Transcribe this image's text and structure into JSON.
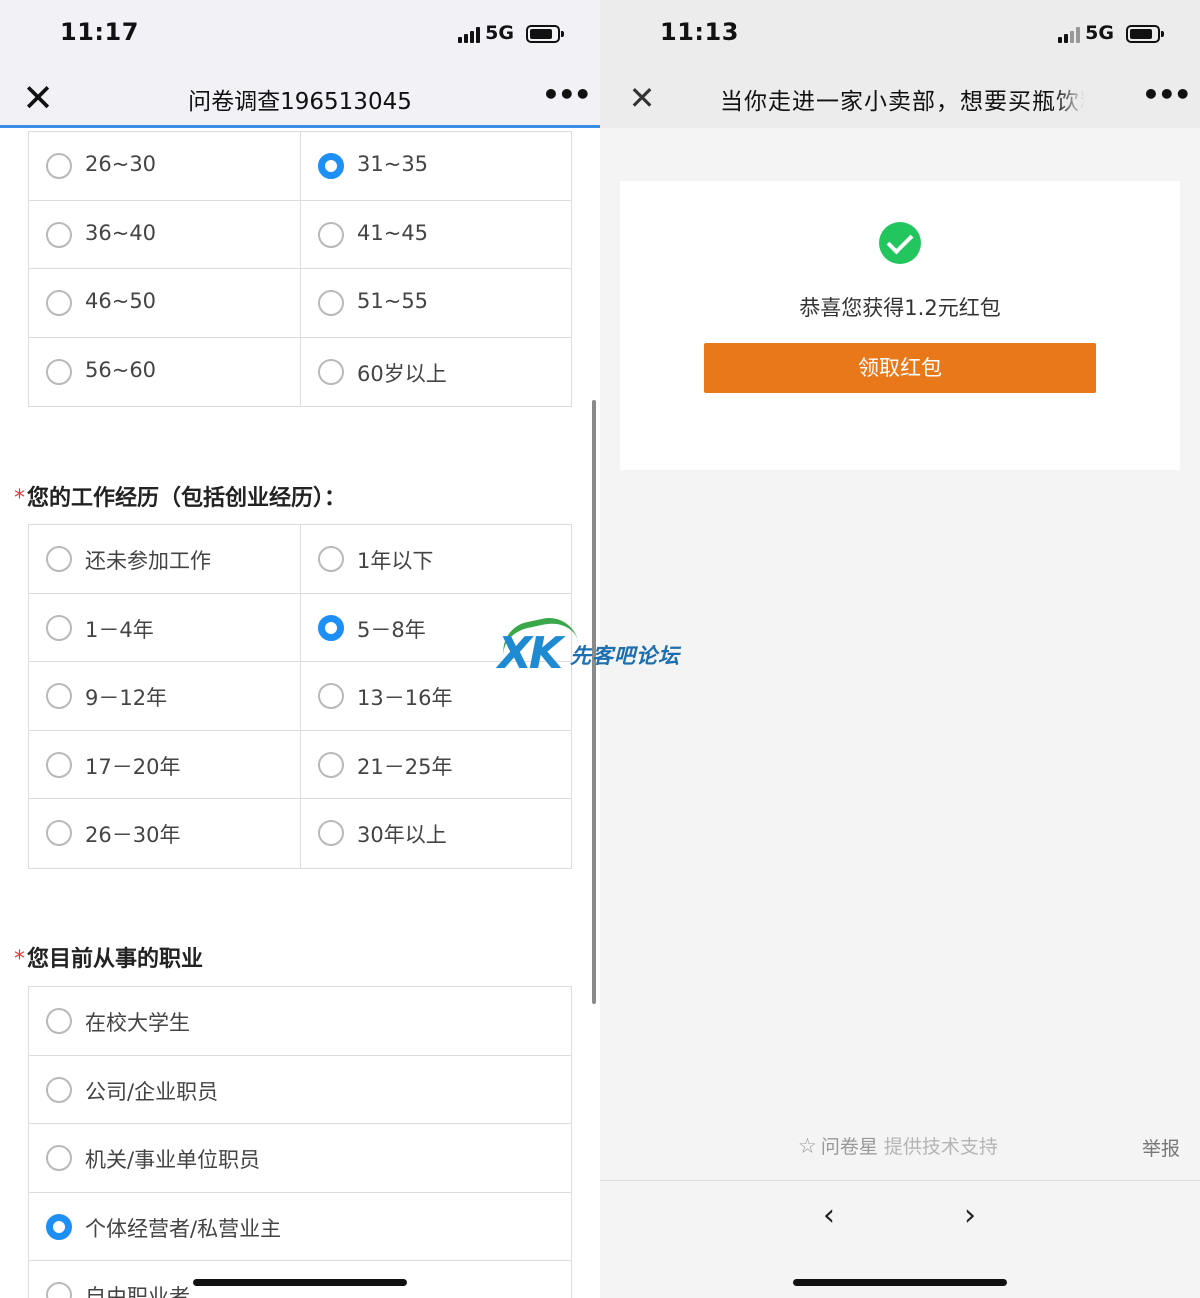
{
  "left": {
    "status": {
      "time": "11:17",
      "network": "5G"
    },
    "nav": {
      "close": "✕",
      "title": "问卷调查196513045",
      "more": "•••"
    },
    "age_options": [
      {
        "label": "26~30",
        "checked": false
      },
      {
        "label": "31~35",
        "checked": true
      },
      {
        "label": "36~40",
        "checked": false
      },
      {
        "label": "41~45",
        "checked": false
      },
      {
        "label": "46~50",
        "checked": false
      },
      {
        "label": "51~55",
        "checked": false
      },
      {
        "label": "56~60",
        "checked": false
      },
      {
        "label": "60岁以上",
        "checked": false
      }
    ],
    "q_work": {
      "required_mark": "*",
      "title": "您的工作经历（包括创业经历）：",
      "options": [
        {
          "label": "还未参加工作",
          "checked": false
        },
        {
          "label": "1年以下",
          "checked": false
        },
        {
          "label": "1－4年",
          "checked": false
        },
        {
          "label": "5－8年",
          "checked": true
        },
        {
          "label": "9－12年",
          "checked": false
        },
        {
          "label": "13－16年",
          "checked": false
        },
        {
          "label": "17－20年",
          "checked": false
        },
        {
          "label": "21－25年",
          "checked": false
        },
        {
          "label": "26－30年",
          "checked": false
        },
        {
          "label": "30年以上",
          "checked": false
        }
      ]
    },
    "q_job": {
      "required_mark": "*",
      "title": "您目前从事的职业",
      "options": [
        {
          "label": "在校大学生",
          "checked": false
        },
        {
          "label": "公司/企业职员",
          "checked": false
        },
        {
          "label": "机关/事业单位职员",
          "checked": false
        },
        {
          "label": "个体经营者/私营业主",
          "checked": true
        },
        {
          "label": "自由职业者",
          "checked": false
        }
      ]
    }
  },
  "right": {
    "status": {
      "time": "11:13",
      "network": "5G"
    },
    "nav": {
      "close": "✕",
      "title": "当你走进一家小卖部，想要买瓶饮料",
      "more": "•••"
    },
    "result": {
      "message": "恭喜您获得1.2元红包",
      "button": "领取红包"
    },
    "footer": {
      "brand": "问卷星",
      "support": "提供技术支持",
      "report": "举报"
    },
    "bottom_nav": {
      "back": "‹",
      "forward": "›"
    }
  },
  "watermark": {
    "logo": "XK",
    "text": "先客吧论坛"
  },
  "colors": {
    "accent": "#1d8ff5",
    "button": "#e8781a",
    "success": "#22c55e",
    "required": "#e03c3c"
  }
}
